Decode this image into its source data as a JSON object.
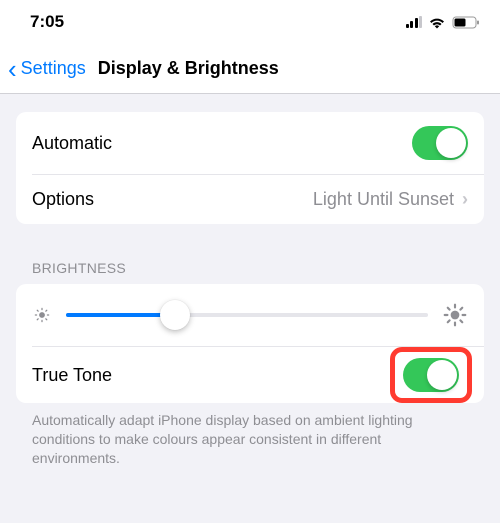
{
  "status": {
    "time": "7:05"
  },
  "nav": {
    "back_label": "Settings",
    "title": "Display & Brightness"
  },
  "appearance": {
    "automatic_label": "Automatic",
    "automatic_enabled": true,
    "options_label": "Options",
    "options_value": "Light Until Sunset"
  },
  "brightness": {
    "header": "BRIGHTNESS",
    "slider_value": 0.3,
    "true_tone_label": "True Tone",
    "true_tone_enabled": true,
    "footer": "Automatically adapt iPhone display based on ambient lighting conditions to make colours appear consistent in different environments."
  },
  "highlight": {
    "target": "true-tone-toggle",
    "color": "#ff3b30"
  }
}
